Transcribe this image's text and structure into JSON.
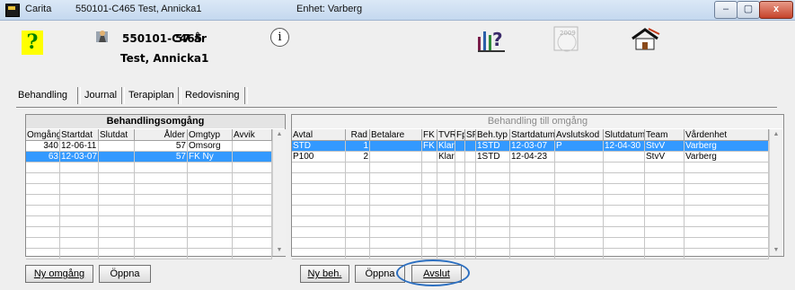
{
  "window": {
    "app_name": "Carita",
    "patient_caption": "550101-C465  Test, Annicka1",
    "unit_caption": "Enhet: Varberg",
    "controls": {
      "minimize": "–",
      "maximize": "▢",
      "close": "x"
    }
  },
  "header": {
    "help_symbol": "?",
    "patient_id": "550101-C465",
    "age": "57 år",
    "patient_name": "Test, Annicka1",
    "info_symbol": "i",
    "chart_icon_text": "?",
    "calendar_icon_text": "2009"
  },
  "tabs": [
    "Behandling",
    "Journal",
    "Terapiplan",
    "Redovisning"
  ],
  "left_panel": {
    "title": "Behandlingsomgång",
    "columns": [
      "Omgång",
      "Startdat",
      "Slutdat",
      "Ålder",
      "Omgtyp",
      "Avvik"
    ],
    "rows": [
      {
        "omgang": "340",
        "startdat": "12-06-11",
        "slutdat": "",
        "alder": "57",
        "omgtyp": "Omsorg",
        "avvik": "",
        "selected": false
      },
      {
        "omgang": "63",
        "startdat": "12-03-07",
        "slutdat": "",
        "alder": "57",
        "omgtyp": "FK Ny",
        "avvik": "",
        "selected": true
      }
    ],
    "buttons": {
      "new": "Ny omgång",
      "open": "Öppna"
    }
  },
  "right_panel": {
    "title": "Behandling till omgång",
    "columns": [
      "Avtal",
      "Rad",
      "Betalare",
      "FK",
      "TVR",
      "Fp",
      "SP",
      "Beh.typ",
      "Startdatum",
      "Avslutskod",
      "Slutdatum",
      "Team",
      "Vårdenhet"
    ],
    "rows": [
      {
        "avtal": "STD",
        "rad": "1",
        "betalare": "",
        "fk": "FK",
        "tvr": "Klar",
        "fp": "",
        "sp": "",
        "behtyp": "1STD",
        "startdatum": "12-03-07",
        "avslutskod": "P",
        "slutdatum": "12-04-30",
        "team": "StvV",
        "vardenhet": "Varberg",
        "selected": true
      },
      {
        "avtal": "P100",
        "rad": "2",
        "betalare": "",
        "fk": "",
        "tvr": "Klar",
        "fp": "",
        "sp": "",
        "behtyp": "1STD",
        "startdatum": "12-04-23",
        "avslutskod": "",
        "slutdatum": "",
        "team": "StvV",
        "vardenhet": "Varberg",
        "selected": false
      }
    ],
    "buttons": {
      "new": "Ny beh.",
      "open": "Öppna",
      "close": "Avslut"
    }
  }
}
